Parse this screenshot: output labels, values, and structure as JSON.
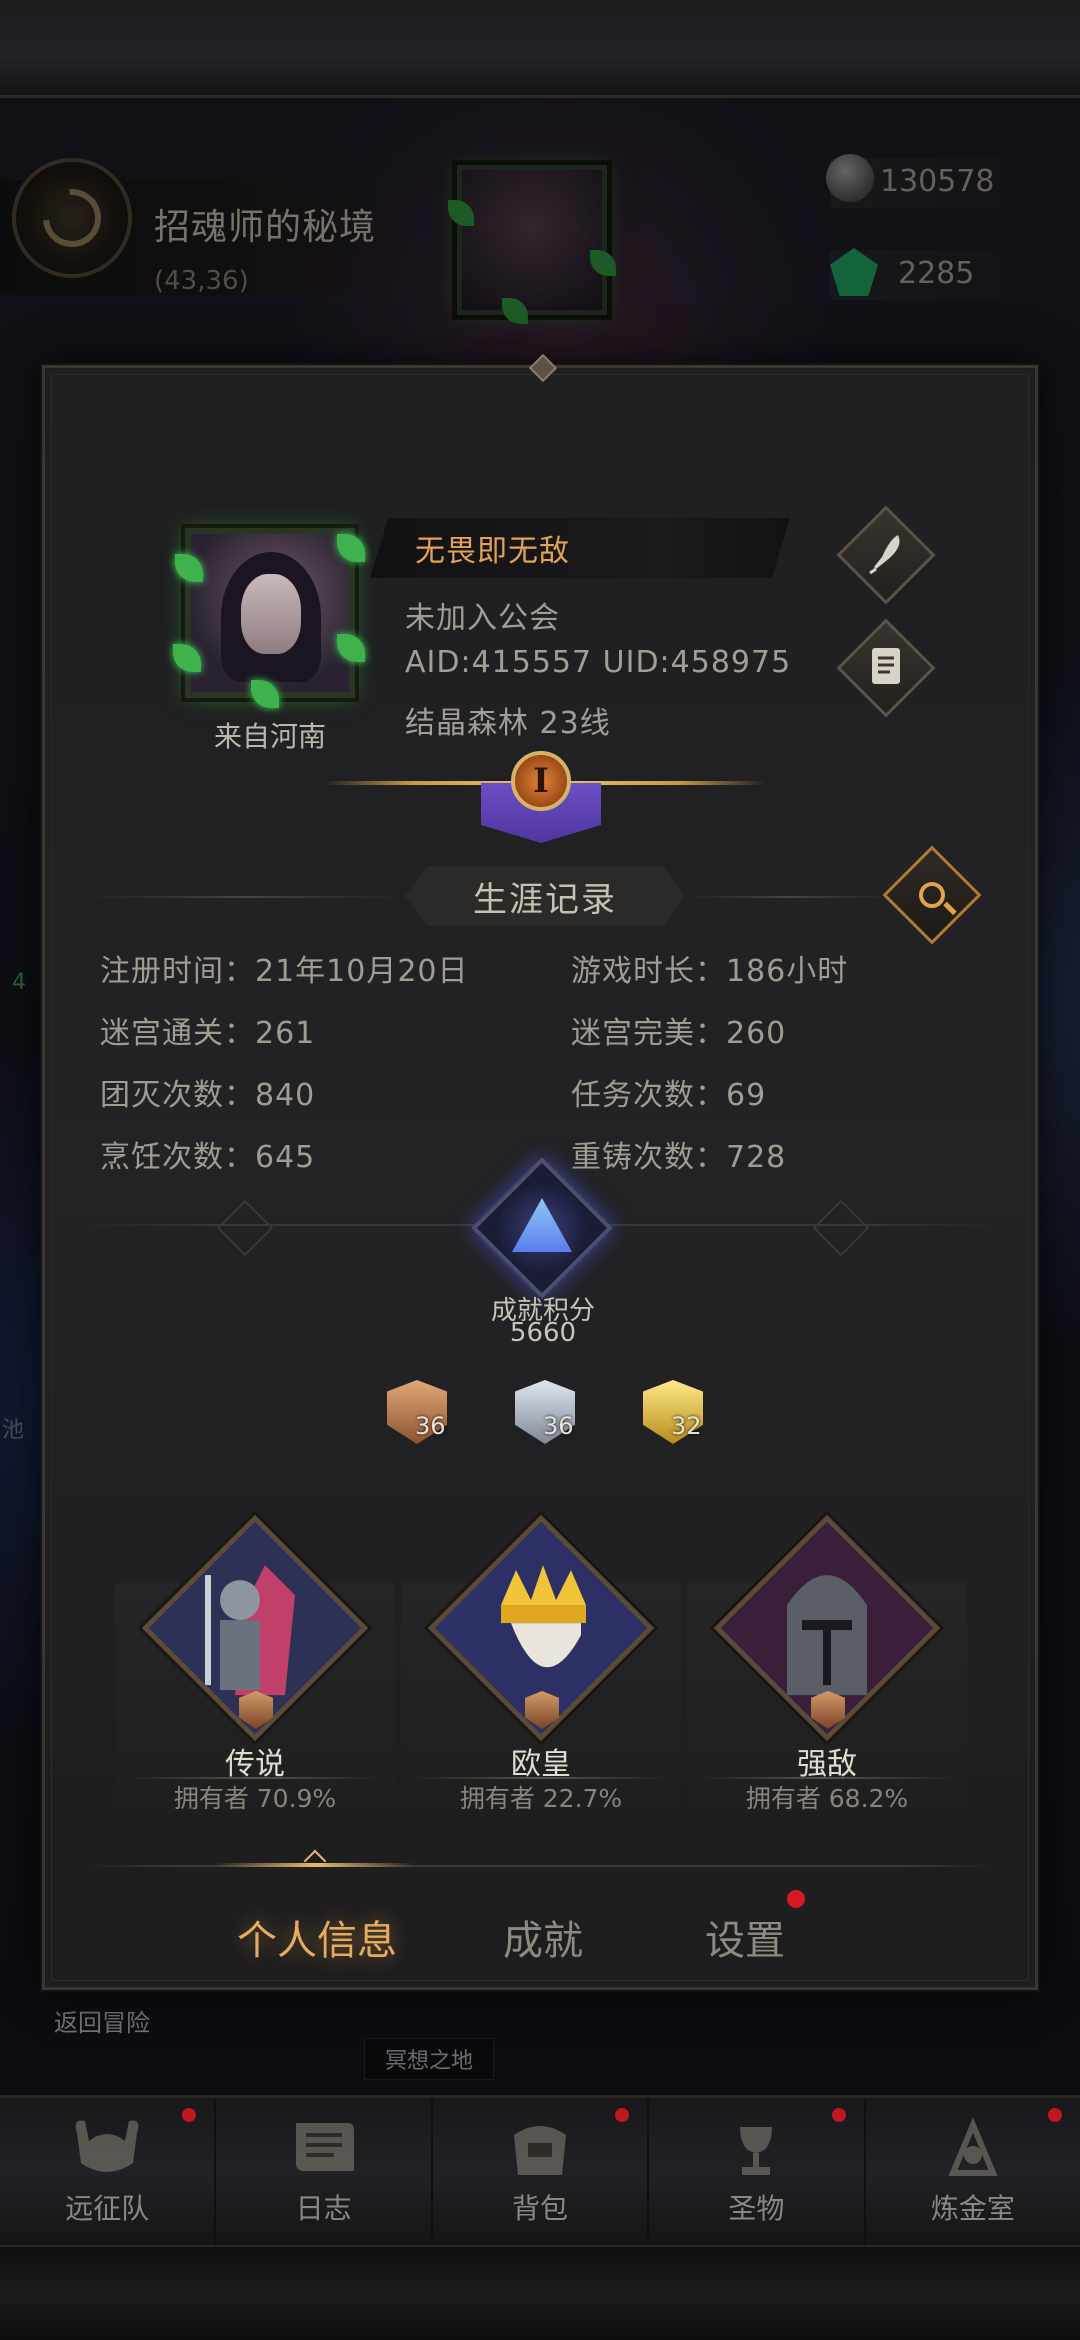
{
  "location": {
    "name": "招魂师的秘境",
    "coords": "(43,36)"
  },
  "resources": [
    {
      "icon": "stone-icon",
      "value": "130578"
    },
    {
      "icon": "emerald-icon",
      "value": "2285"
    }
  ],
  "background_labels": {
    "left_green": "4",
    "left_pool": "池",
    "back": "返回冒险",
    "area": "冥想之地"
  },
  "profile": {
    "name": "无畏即无敌",
    "guild": "未加入公会",
    "ids": "AID:415557 UID:458975",
    "server": "结晶森林  23线",
    "origin": "来自河南",
    "rank_numeral": "I"
  },
  "career": {
    "title": "生涯记录",
    "stats": [
      {
        "label": "注册时间：21年10月20日"
      },
      {
        "label": "游戏时长：186小时"
      },
      {
        "label": "迷宫通关：261"
      },
      {
        "label": "迷宫完美：260"
      },
      {
        "label": "团灭次数：840"
      },
      {
        "label": "任务次数：69"
      },
      {
        "label": "烹饪次数：645"
      },
      {
        "label": "重铸次数：728"
      }
    ]
  },
  "achievements": {
    "label": "成就积分",
    "score": "5660",
    "medals": [
      {
        "tier": "bronze",
        "count": "36"
      },
      {
        "tier": "silver",
        "count": "36"
      },
      {
        "tier": "gold",
        "count": "32"
      }
    ],
    "titles": [
      {
        "name": "传说",
        "owners": "拥有者 70.9%"
      },
      {
        "name": "欧皇",
        "owners": "拥有者 22.7%"
      },
      {
        "name": "强敌",
        "owners": "拥有者 68.2%"
      }
    ]
  },
  "tabs": [
    {
      "label": "个人信息",
      "active": true
    },
    {
      "label": "成就",
      "active": false
    },
    {
      "label": "设置",
      "active": false,
      "badge": true
    }
  ],
  "bottom_nav": [
    {
      "label": "远征队",
      "icon": "helmet-icon"
    },
    {
      "label": "日志",
      "icon": "scroll-icon"
    },
    {
      "label": "背包",
      "icon": "bag-icon"
    },
    {
      "label": "圣物",
      "icon": "chalice-icon"
    },
    {
      "label": "炼金室",
      "icon": "alchemy-icon"
    }
  ],
  "colors": {
    "accent_gold": "#e2ad60",
    "notify_red": "#d51a23",
    "panel": "#222224"
  }
}
